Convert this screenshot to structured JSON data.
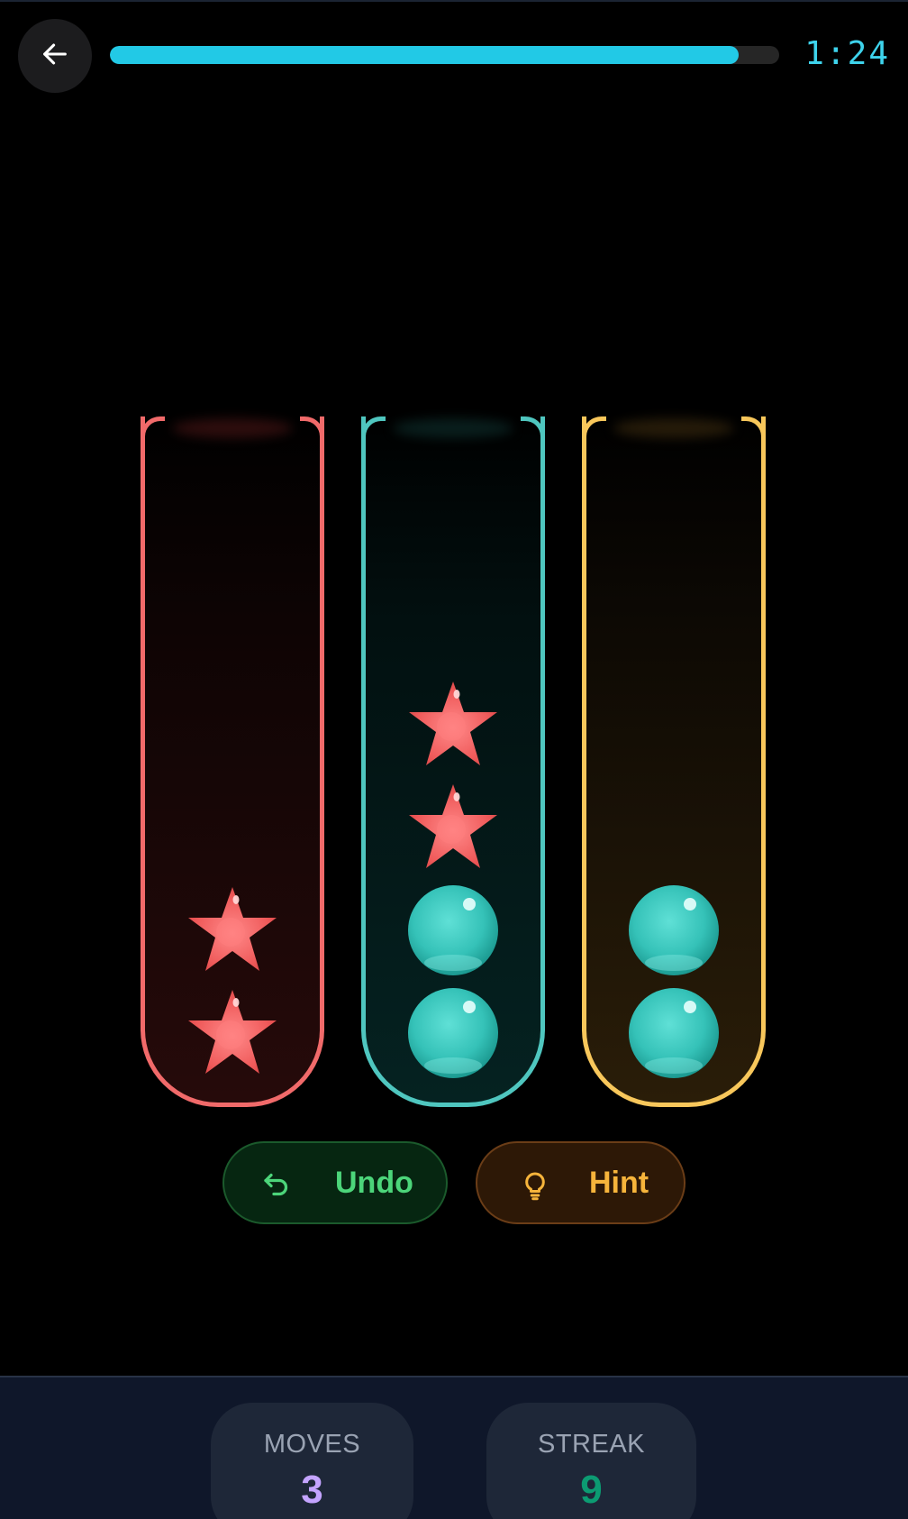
{
  "header": {
    "back_icon": "arrow-left-icon",
    "timer": "1:24",
    "progress": 0.94,
    "progress_color": "#22c9e6"
  },
  "tubes": [
    {
      "color": "#f16a6a",
      "pieces_bottom_to_top": [
        "red-star",
        "red-star"
      ]
    },
    {
      "color": "#4fc6bf",
      "pieces_bottom_to_top": [
        "teal-ball",
        "teal-ball",
        "red-star",
        "red-star"
      ]
    },
    {
      "color": "#f8c75b",
      "pieces_bottom_to_top": [
        "teal-ball",
        "teal-ball"
      ]
    }
  ],
  "actions": {
    "undo": {
      "label": "Undo",
      "icon": "undo-icon",
      "color": "#4cd57a"
    },
    "hint": {
      "label": "Hint",
      "icon": "lightbulb-icon",
      "color": "#f6b43b"
    }
  },
  "stats": {
    "moves": {
      "label": "MOVES",
      "value": "3"
    },
    "streak": {
      "label": "STREAK",
      "value": "9"
    }
  }
}
